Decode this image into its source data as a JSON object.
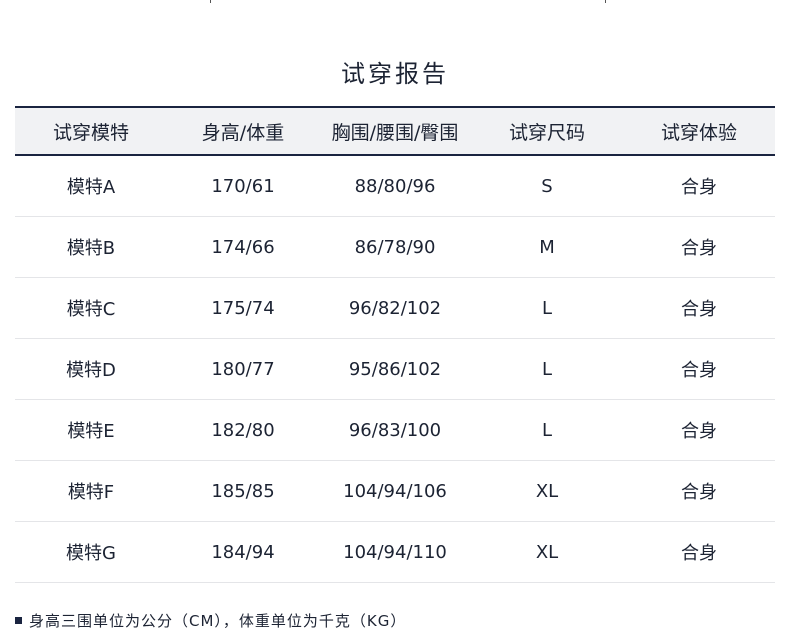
{
  "title": "试穿报告",
  "headers": [
    "试穿模特",
    "身高/体重",
    "胸围/腰围/臀围",
    "试穿尺码",
    "试穿体验"
  ],
  "rows": [
    [
      "模特A",
      "170/61",
      "88/80/96",
      "S",
      "合身"
    ],
    [
      "模特B",
      "174/66",
      "86/78/90",
      "M",
      "合身"
    ],
    [
      "模特C",
      "175/74",
      "96/82/102",
      "L",
      "合身"
    ],
    [
      "模特D",
      "180/77",
      "95/86/102",
      "L",
      "合身"
    ],
    [
      "模特E",
      "182/80",
      "96/83/100",
      "L",
      "合身"
    ],
    [
      "模特F",
      "185/85",
      "104/94/106",
      "XL",
      "合身"
    ],
    [
      "模特G",
      "184/94",
      "104/94/110",
      "XL",
      "合身"
    ]
  ],
  "note": "身高三围单位为公分（CM），体重单位为千克（KG）"
}
